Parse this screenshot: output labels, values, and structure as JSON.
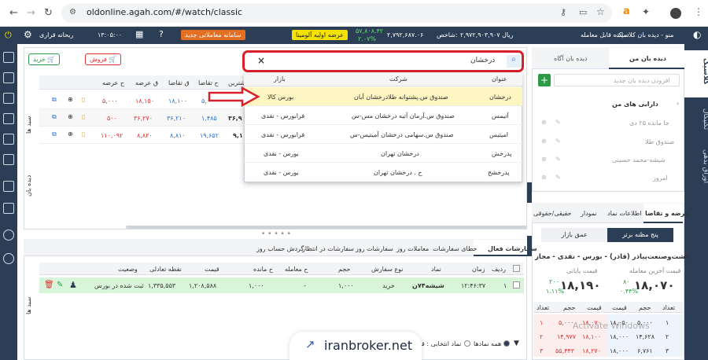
{
  "browser": {
    "url": "oldonline.agah.com/#/watch/classic"
  },
  "header": {
    "menu": "منو - دیده بان کلاسیک",
    "balance_label": "مانده قابل معامله:",
    "balance_value": "۲,۹۷۲,۹۰۳,۹۰۷ ریال",
    "index_label": "شاخص:",
    "index_value": "۲,۷۹۲,۶۸۷.۰۶",
    "index_change": "۵۷,۸۰۸.۴۲",
    "index_pct": "۲.۰۷%",
    "ipo_button": "عرضه اولیه آلومینا",
    "new_system_button": "سامانه معاملاتی جدید",
    "time": "۱۳:۰۵:۰۰",
    "notif": "ریحانه قراری"
  },
  "trade_buttons": {
    "sell": "فروش",
    "buy": "خرید"
  },
  "market_table": {
    "side_label": "سبد ها",
    "side_label2": "دیده بان",
    "headers": [
      "ح عرضه",
      "ق عرضه",
      "ق تقاضا",
      "ح تقاضا",
      "شترین"
    ],
    "rows": [
      [
        "۵,۰۰۰",
        "۱۸,۱۵۰",
        "۱۸,۱۰۰",
        "۵,۰"
      ],
      [
        "۵۰۰",
        "۳۶,۲۷۰",
        "۳۶,۲۱۰",
        "۱,۴۸۵",
        "۳۶,۹"
      ],
      [
        "۱۱۰,۰۹۲",
        "۸,۸۲۰",
        "۸,۸۱۰",
        "۱۹,۶۵۲",
        "۹,۱"
      ]
    ]
  },
  "search": {
    "query": "درخشان",
    "clear": "×",
    "headers": [
      "عنوان",
      "شرکت",
      "بازار"
    ],
    "results": [
      {
        "symbol": "درخشان",
        "company": "صندوق س.پشتوانه طلادرخشان آبان",
        "market": "بورس کالا"
      },
      {
        "symbol": "آتیمس",
        "company": "صندوق س.آرمان آتیه درخشان مس-س",
        "market": "فرابورس - نقدی"
      },
      {
        "symbol": "امیتیس",
        "company": "صندوق س.سهامی درخشان آمیتیس-س",
        "market": "فرابورس - نقدی"
      },
      {
        "symbol": "پدرخش",
        "company": "درخشان تهران",
        "market": "بورس - نقدی"
      },
      {
        "symbol": "پدرخشح",
        "company": "ح . درخشان تهران",
        "market": "بورس - نقدی"
      }
    ]
  },
  "watch": {
    "tabs": [
      "دیده بان من",
      "دیده بان آگاه"
    ],
    "add_placeholder": "افزودن دیده بان جدید",
    "items": [
      "دارایی های من",
      "جا مانده ۲۵ دی",
      "صندوق طلا",
      "شیشه-محمد حسینی",
      "امروز",
      "پتروپالا"
    ]
  },
  "right_strip": [
    "کلاسیک",
    "تکنیکال",
    "اوراق بدهی"
  ],
  "detail": {
    "tabs": [
      "عرضه و تقاضا",
      "اطلاعات نماد",
      "نمودار",
      "حقیقی/حقوقی"
    ],
    "subtabs": [
      "پنج مظنه برتر",
      "عمق بازار"
    ],
    "title": "کشت‌وصنعت‌پیاذر (قاذر) - بورس - نقدی - مجاز",
    "last_label": "قیمت آخرین معامله",
    "last_price": "۱۸,۰۷۰",
    "last_change": "۸۰",
    "last_pct": "۰.۴۴%",
    "close_label": "قیمت پایانی",
    "close_price": "۱۸,۱۹۰",
    "close_change": "۲۰۰",
    "close_pct": "۱.۱۱%",
    "ob_headers": [
      "تعداد",
      "حجم",
      "قیمت",
      "قیمت",
      "حجم",
      "تعداد"
    ],
    "ob_rows": [
      [
        "۱",
        "۵,۰۰۰",
        "۱۸,۰۵۰",
        "۱۸,۰۷۰",
        "۵,۰۰۰",
        "۱"
      ],
      [
        "۲",
        "۱۴,۶۲۸",
        "۱۸,۰۰۰",
        "۱۸,۱۰۰",
        "۱۴,۹۷۷",
        "۲"
      ],
      [
        "۳",
        "۶,۷۶۱",
        "۱۸,۰۰۰",
        "۱۸,۲۷۰",
        "۵۵,۴۴۳",
        "۳"
      ]
    ],
    "watermark": "Activate Windows"
  },
  "orders": {
    "tabs": [
      "سفارشات فعال",
      "خطای سفارشات",
      "معاملات روز",
      "سفارشات روز",
      "سفارشات در انتظار",
      "گردش حساب روز"
    ],
    "side_label": "سبد ها",
    "headers": [
      "ردیف",
      "زمان",
      "نماد",
      "نوع سفارش",
      "حجم",
      "ح معامله",
      "ح مانده",
      "قیمت",
      "نقطه تعادلی",
      "وضعیت"
    ],
    "row": [
      "۱",
      "۱۲:۴۶:۳۷",
      "شیشه۷۴ن",
      "خرید",
      "۱,۰۰۰",
      "-",
      "۱,۰۰۰",
      "۱,۲۰۸,۵۸۸",
      "۱,۳۳۵,۵۵۳",
      "ثبت شده در بورس"
    ],
    "filter_all": "همه نمادها",
    "filter_sel": "نماد انتخابی : قاذ"
  },
  "brand": "iranbroker.net",
  "colors": {
    "header": "#2c3e55",
    "accent": "#e36f24",
    "highlight": "#fdf6c3",
    "orderRow": "#d9f5d9",
    "red": "#d8202a"
  }
}
